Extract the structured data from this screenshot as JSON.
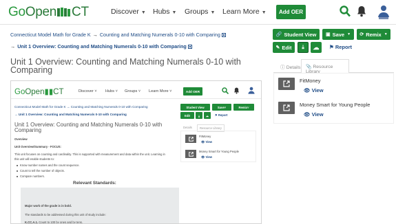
{
  "header": {
    "logo_go": "Go",
    "logo_open": "Open",
    "logo_ct": "CT",
    "nav": [
      "Discover",
      "Hubs",
      "Groups",
      "Learn More"
    ],
    "add_oer": "Add OER"
  },
  "breadcrumb": {
    "parent": "Connecticut Model Math for Grade K",
    "item": "Counting and Matching Numerals 0-10 with Comparing",
    "current": "Unit 1 Overview: Counting and Matching Numerals 0-10 with Comparing"
  },
  "page_title": "Unit 1 Overview: Counting and Matching Numerals 0-10 with Comparing",
  "actions": {
    "student_view": "Student View",
    "save": "Save",
    "remix": "Remix",
    "edit": "Edit",
    "report": "Report"
  },
  "tabs": {
    "details": "Details",
    "resource_library": "Resource Library"
  },
  "resources": [
    {
      "name": "FitMoney",
      "view": "View"
    },
    {
      "name": "Money Smart for Young People",
      "view": "View"
    }
  ],
  "embedded": {
    "overview_heading": "Overview",
    "summary_label": "Unit Overview/Summary - FOCUS:",
    "summary_text": "This unit focuses on counting and cardinality. This is supported with measurement and data within the unit. Learning in",
    "summary_text2": "this unit will enable students to:",
    "bullets": [
      "Know number names and the count sequence.",
      "Count to tell the number of objects.",
      "Compare numbers."
    ],
    "standards_heading": "Relevant Standards:",
    "major_work": "Major work of the grade is in bold.",
    "standards_note": "The standards to be addressed during this unit of study include:",
    "standard_code": "K.CC.A.1.",
    "standard_text": "Count to 100 by ones and by tens."
  },
  "colors": {
    "brand_green": "#1f8b38",
    "link_blue": "#1f4c86",
    "icon_gray": "#606060"
  }
}
